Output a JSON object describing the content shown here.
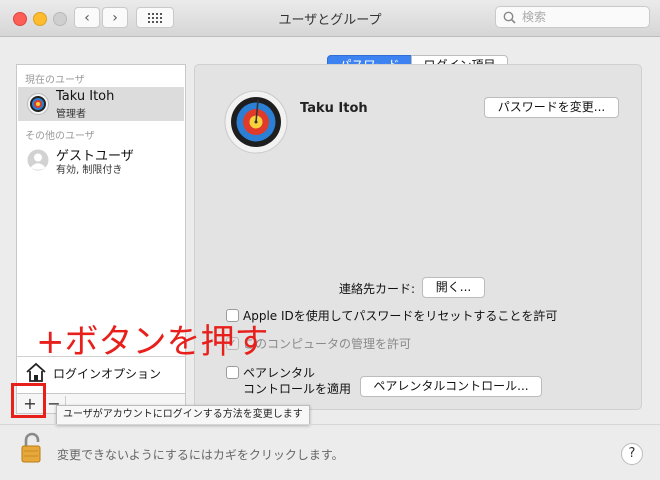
{
  "window": {
    "title": "ユーザとグループ"
  },
  "toolbar": {
    "back": "‹",
    "forward": "›",
    "search_placeholder": "検索"
  },
  "sidebar": {
    "current_section": "現在のユーザ",
    "current_user": {
      "name": "Taku Itoh",
      "role": "管理者"
    },
    "other_section": "その他のユーザ",
    "other_users": [
      {
        "name": "ゲストユーザ",
        "role": "有効, 制限付き"
      }
    ],
    "login_options": "ログインオプション",
    "add": "+",
    "remove": "−"
  },
  "tabs": [
    {
      "label": "パスワード",
      "selected": true
    },
    {
      "label": "ログイン項目",
      "selected": false
    }
  ],
  "main": {
    "user_name": "Taku Itoh",
    "change_password": "パスワードを変更...",
    "contact_card_label": "連絡先カード:",
    "open_button": "開く...",
    "allow_apple_id": "Apple IDを使用してパスワードをリセットすることを許可",
    "allow_admin": "このコンピュータの管理を許可",
    "parental_line1": "ペアレンタル",
    "parental_line2": "コントロールを適用",
    "parental_button": "ペアレンタルコントロール..."
  },
  "tooltip": "ユーザがアカウントにログインする方法を変更します",
  "lock_text": "変更できないようにするにはカギをクリックします。",
  "help": "?",
  "annotation": "+ボタンを押す",
  "colors": {
    "accent": "#3c82f0",
    "annotation": "#e8201c",
    "selected_row": "#dcdcdc"
  }
}
